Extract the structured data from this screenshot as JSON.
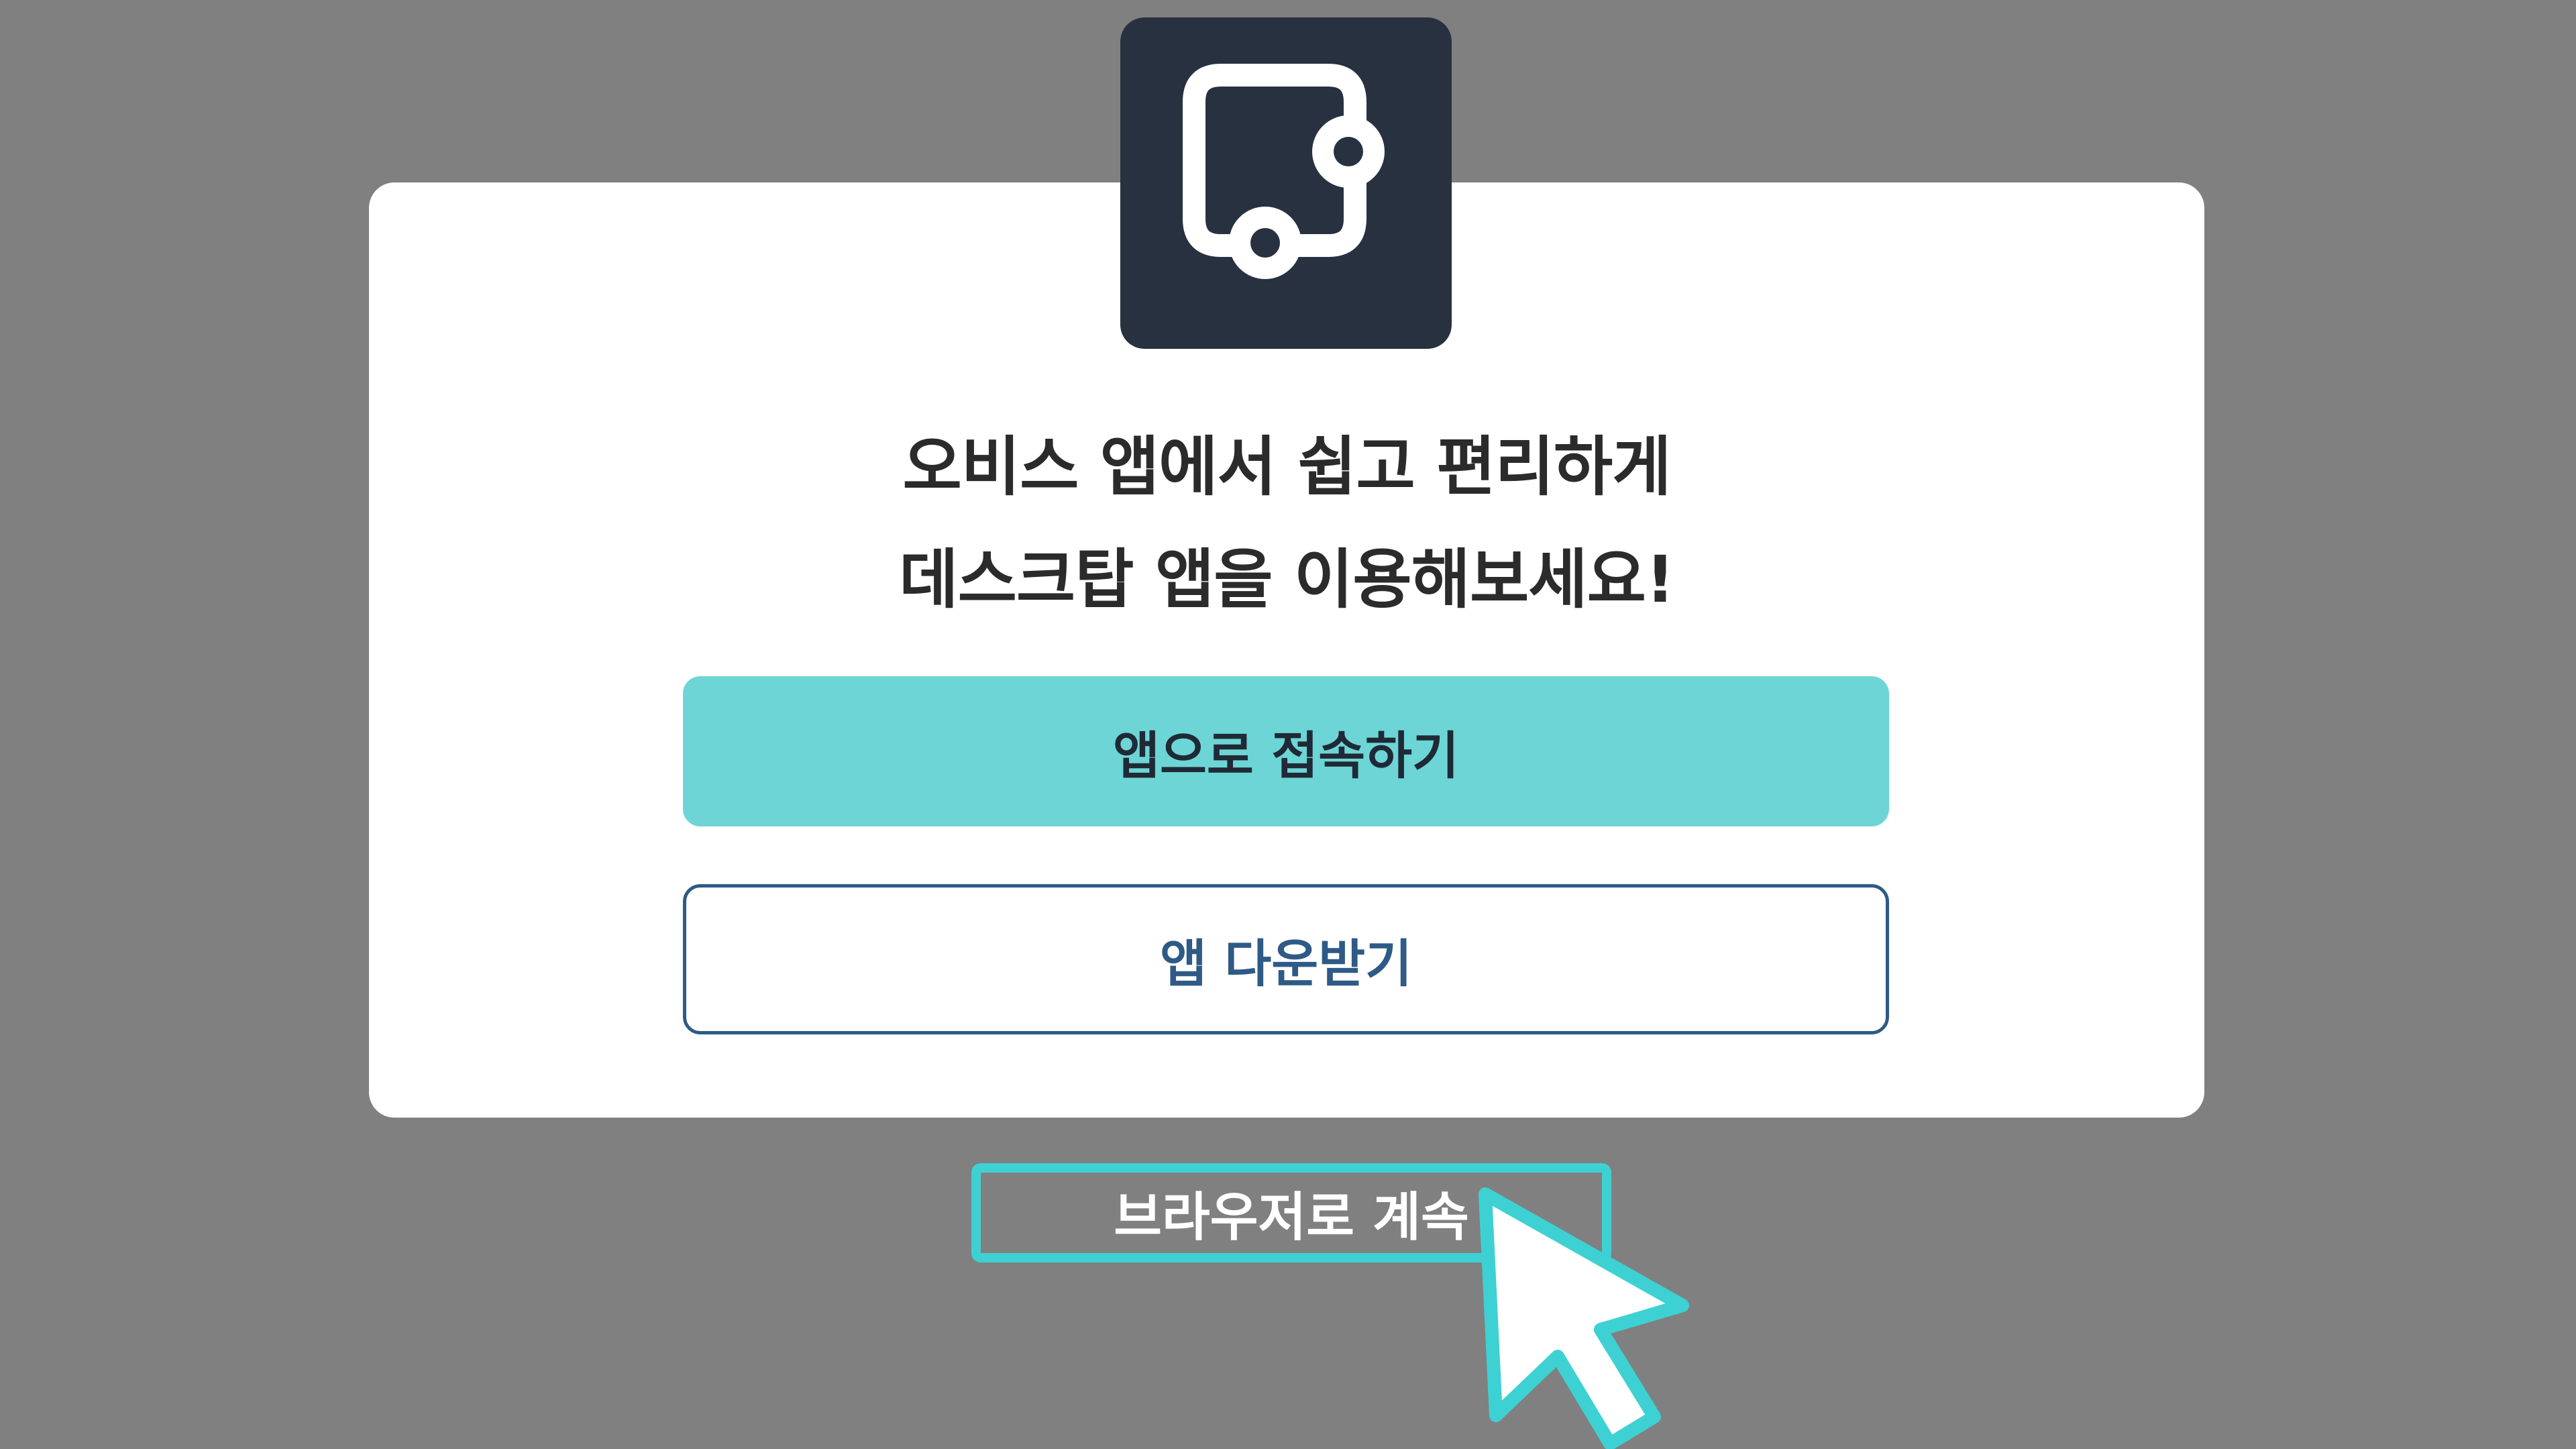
{
  "background_color": "#808080",
  "dialog": {
    "logo_icon": "desktop-app-window-icon",
    "headline_line1": "오비스 앱에서 쉽고 편리하게",
    "headline_line2": "데스크탑 앱을 이용해보세요!",
    "primary_button_label": "앱으로 접속하기",
    "secondary_button_label": "앱 다운받기"
  },
  "continue_in_browser_label": "브라우저로 계속",
  "pointer_icon": "mouse-pointer-icon",
  "colors": {
    "logo_bg": "#28313f",
    "primary_button": "#6dd5d5",
    "secondary_button_border": "#2f5a86",
    "highlight": "#3ed1d3"
  }
}
